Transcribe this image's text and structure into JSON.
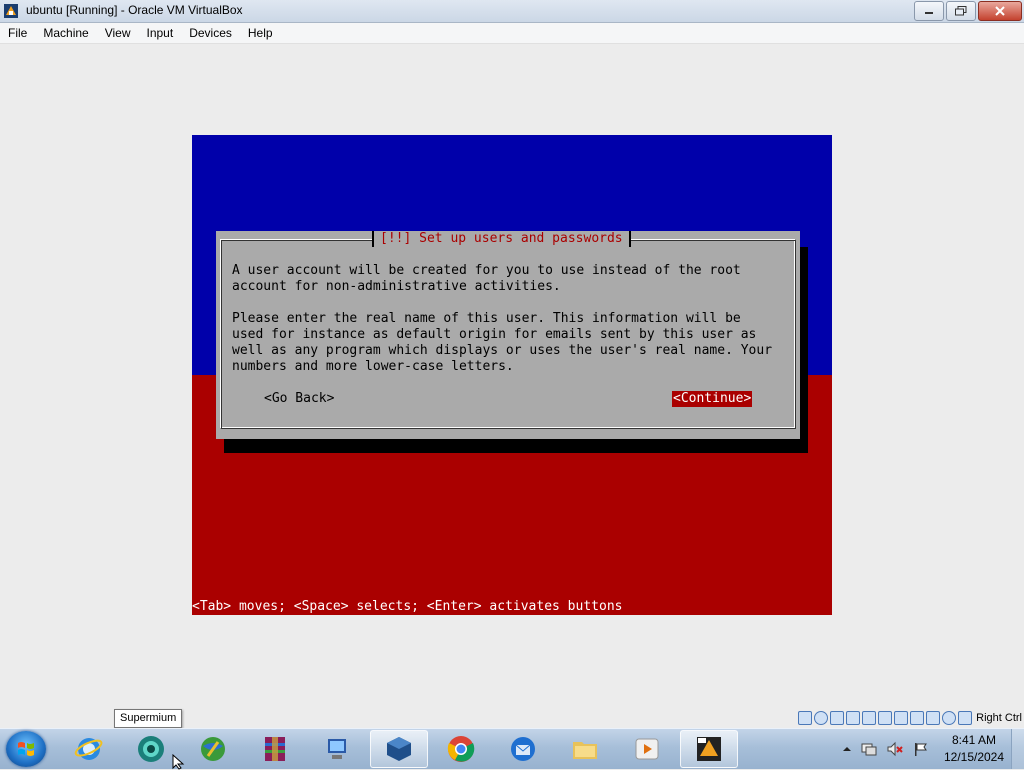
{
  "window": {
    "title": "ubuntu [Running] - Oracle VM VirtualBox",
    "app_icon": "virtualbox-icon"
  },
  "menubar": {
    "items": [
      "File",
      "Machine",
      "View",
      "Input",
      "Devices",
      "Help"
    ]
  },
  "vm": {
    "dialog": {
      "title": "[!!] Set up users and passwords",
      "body": "A user account will be created for you to use instead of the root\naccount for non-administrative activities.\n\nPlease enter the real name of this user. This information will be\nused for instance as default origin for emails sent by this user as\nwell as any program which displays or uses the user's real name. Your\nnumbers and more lower-case letters.",
      "back_label": "<Go Back>",
      "continue_label": "<Continue>"
    },
    "status_line": "<Tab> moves; <Space> selects; <Enter> activates buttons",
    "colors": {
      "top": "#0000aa",
      "bottom": "#aa0000",
      "dialog": "#aaaaaa",
      "title_text": "#aa0000"
    }
  },
  "vbox_status": {
    "icons": [
      "hard-disk-icon",
      "optical-drive-icon",
      "audio-icon",
      "network-icon",
      "usb-icon",
      "shared-folders-icon",
      "display-icon",
      "recording-icon",
      "cpu-icon",
      "mouse-integration-icon",
      "keyboard-icon"
    ],
    "host_key": "Right Ctrl"
  },
  "tooltip": "Supermium",
  "taskbar": {
    "apps": [
      "internet-explorer-icon",
      "supermium-icon",
      "network-globe-icon",
      "winrar-icon",
      "network-computer-icon",
      "virtualbox-manager-icon",
      "chrome-icon",
      "thunderbird-icon",
      "file-explorer-icon",
      "media-player-icon",
      "virtualbox-vm-icon"
    ],
    "clock": {
      "time": "8:41 AM",
      "date": "12/15/2024"
    }
  }
}
